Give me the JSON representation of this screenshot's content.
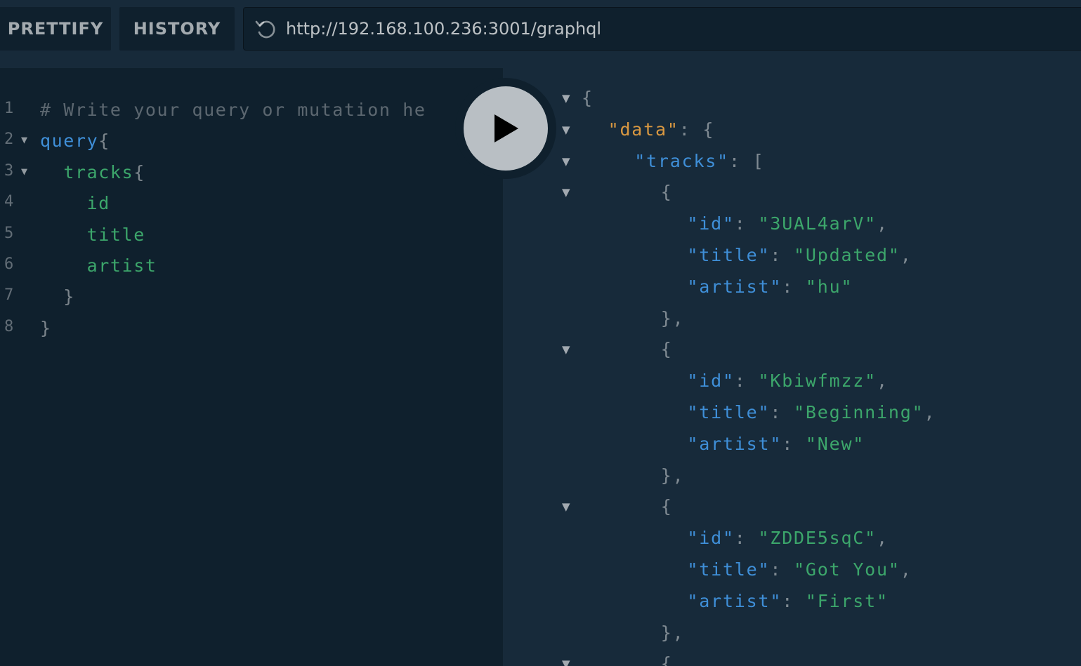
{
  "toolbar": {
    "prettify_label": "PRETTIFY",
    "history_label": "HISTORY",
    "endpoint_url": "http://192.168.100.236:3001/graphql",
    "reload_icon": "reload-icon"
  },
  "editor": {
    "lines": [
      {
        "num": "1",
        "text": "# Write your query or mutation here"
      },
      {
        "num": "2",
        "text": "query{"
      },
      {
        "num": "3",
        "text": "  tracks{"
      },
      {
        "num": "4",
        "text": "    id"
      },
      {
        "num": "5",
        "text": "    title"
      },
      {
        "num": "6",
        "text": "    artist"
      },
      {
        "num": "7",
        "text": "  }"
      },
      {
        "num": "8",
        "text": "}"
      }
    ],
    "comment_visible": "# Write your query or mutation he",
    "keyword": "query",
    "root_field": "tracks",
    "fields": [
      "id",
      "title",
      "artist"
    ]
  },
  "execute_button": {
    "icon": "play-icon"
  },
  "result": {
    "data_key": "\"data\"",
    "tracks_key": "\"tracks\"",
    "field_keys": {
      "id": "\"id\"",
      "title": "\"title\"",
      "artist": "\"artist\""
    },
    "tracks": [
      {
        "id": "\"3UAL4arV\"",
        "title": "\"Updated\"",
        "artist": "\"hu\""
      },
      {
        "id": "\"Kbiwfmzz\"",
        "title": "\"Beginning\"",
        "artist": "\"New\""
      },
      {
        "id": "\"ZDDE5sqC\"",
        "title": "\"Got You\"",
        "artist": "\"First\""
      }
    ]
  },
  "colors": {
    "editor_bg": "#0f202d",
    "result_bg": "#172a3a",
    "keyword": "#3f8fd8",
    "field": "#3ca66b",
    "data_key": "#d99841"
  }
}
